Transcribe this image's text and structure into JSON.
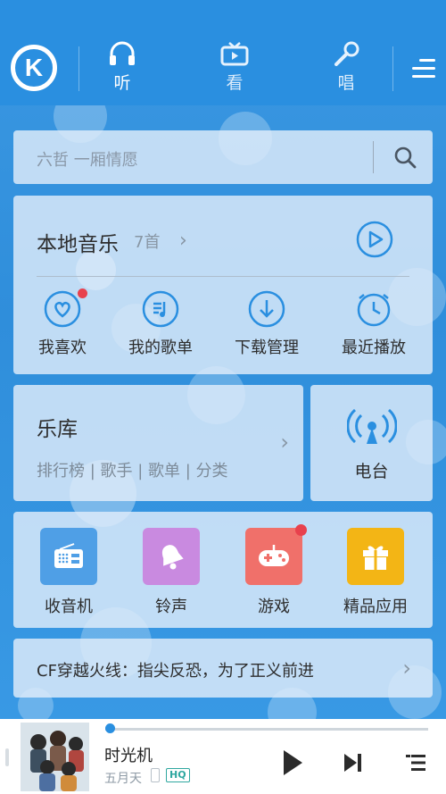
{
  "nav": {
    "logo_letter": "K",
    "tabs": [
      {
        "label": "听",
        "icon": "headphones-icon",
        "active": true
      },
      {
        "label": "看",
        "icon": "tv-icon",
        "active": false
      },
      {
        "label": "唱",
        "icon": "microphone-icon",
        "active": false
      }
    ],
    "menu_icon": "hamburger-menu-icon"
  },
  "search": {
    "placeholder": "六哲 一厢情愿",
    "icon": "search-icon"
  },
  "local_music": {
    "title": "本地音乐",
    "count": "7首",
    "play_icon": "play-circle-icon",
    "quick_items": [
      {
        "label": "我喜欢",
        "icon": "heart-icon",
        "badge": true
      },
      {
        "label": "我的歌单",
        "icon": "playlist-icon",
        "badge": false
      },
      {
        "label": "下载管理",
        "icon": "download-icon",
        "badge": false
      },
      {
        "label": "最近播放",
        "icon": "clock-icon",
        "badge": false
      }
    ]
  },
  "library": {
    "title": "乐库",
    "subtitle": "排行榜 | 歌手 | 歌单 | 分类"
  },
  "radio": {
    "label": "电台",
    "icon": "broadcast-icon"
  },
  "apps": [
    {
      "label": "收音机",
      "icon": "radio-icon",
      "color": "#4f9fe6",
      "badge": false
    },
    {
      "label": "铃声",
      "icon": "bell-icon",
      "color": "#c98ae0",
      "badge": false
    },
    {
      "label": "游戏",
      "icon": "gamepad-icon",
      "color": "#f0706a",
      "badge": true
    },
    {
      "label": "精品应用",
      "icon": "gift-icon",
      "color": "#f3b515",
      "badge": false
    }
  ],
  "banner": {
    "text": "CF穿越火线：指尖反恐，为了正义前进"
  },
  "player": {
    "song": "时光机",
    "artist": "五月天",
    "quality": "HQ",
    "progress": 0.01
  },
  "colors": {
    "accent": "#2a8fe0",
    "badge": "#e8414d"
  }
}
